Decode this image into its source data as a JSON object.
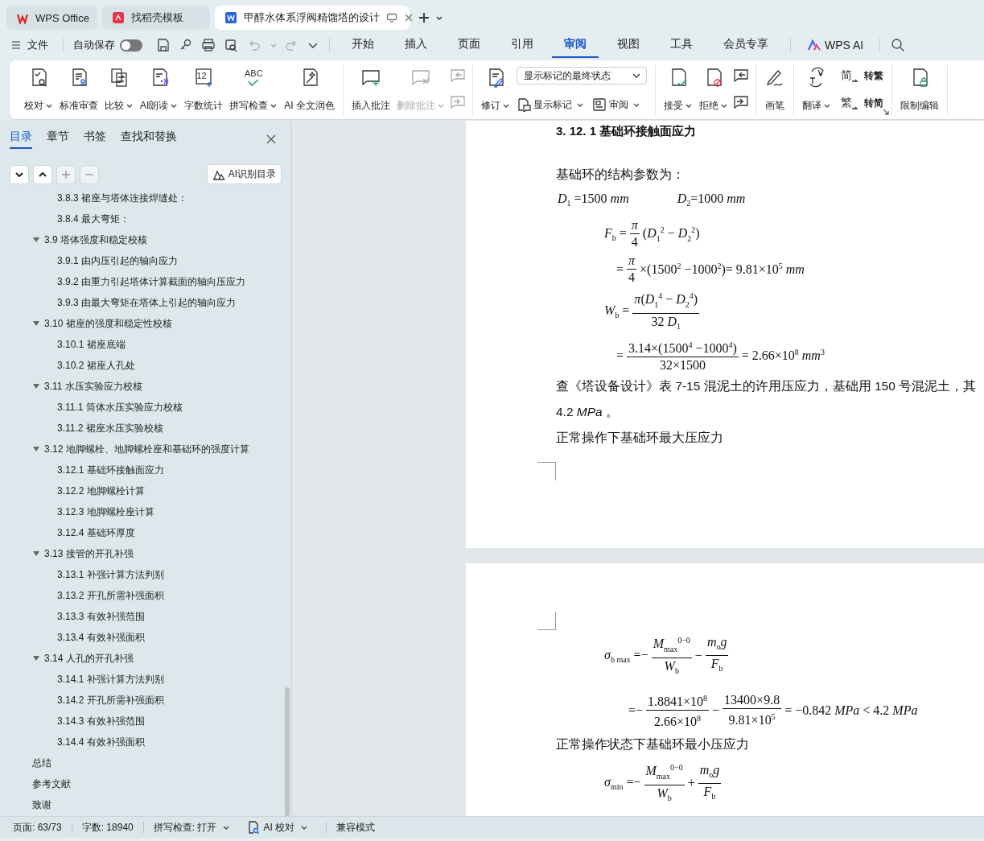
{
  "app_tabs": [
    {
      "label": "WPS Office",
      "selected": false
    },
    {
      "label": "找稻壳模板",
      "selected": false
    },
    {
      "label": "甲醇水体系浮阀精馏塔的设计",
      "selected": true
    }
  ],
  "menubar": {
    "file": "文件",
    "autosave": {
      "label": "自动保存",
      "on": false
    },
    "tabs": [
      {
        "label": "开始",
        "selected": false
      },
      {
        "label": "插入",
        "selected": false
      },
      {
        "label": "页面",
        "selected": false
      },
      {
        "label": "引用",
        "selected": false
      },
      {
        "label": "审阅",
        "selected": true
      },
      {
        "label": "视图",
        "selected": false
      },
      {
        "label": "工具",
        "selected": false
      },
      {
        "label": "会员专享",
        "selected": false
      }
    ],
    "ai_button": "WPS AI"
  },
  "ribbon": {
    "groups": [
      {
        "items": [
          {
            "kind": "large",
            "label": "校对",
            "caret": true,
            "disabled": false
          },
          {
            "kind": "large",
            "label": "标准审查",
            "caret": false,
            "disabled": false
          },
          {
            "kind": "large",
            "label": "比较",
            "caret": true,
            "disabled": false
          },
          {
            "kind": "large",
            "label": "AI朗读",
            "caret": true,
            "disabled": false
          },
          {
            "kind": "large",
            "label": "字数统计",
            "caret": false,
            "disabled": false,
            "glyph": "12"
          },
          {
            "kind": "large",
            "label": "拼写检查",
            "caret": true,
            "disabled": false,
            "glyph": "ABC"
          },
          {
            "kind": "large",
            "label": "AI 全文润色",
            "caret": false,
            "disabled": false
          }
        ]
      },
      {
        "items": [
          {
            "kind": "large",
            "label": "插入批注",
            "caret": false,
            "disabled": false
          },
          {
            "kind": "large",
            "label": "删除批注",
            "caret": true,
            "disabled": true
          },
          {
            "kind": "icon-pair",
            "disabled": true
          }
        ]
      },
      {
        "items": [
          {
            "kind": "large",
            "label": "修订",
            "caret": true,
            "disabled": false
          },
          {
            "kind": "stack",
            "select": "显示标记的最终状态",
            "buttons": [
              {
                "label": "显示标记",
                "caret": true
              },
              {
                "label": "审阅",
                "caret": true
              }
            ]
          }
        ]
      },
      {
        "items": [
          {
            "kind": "large",
            "label": "接受",
            "caret": true,
            "disabled": false
          },
          {
            "kind": "large",
            "label": "拒绝",
            "caret": true,
            "disabled": false
          },
          {
            "kind": "icon-pair",
            "disabled": false
          }
        ]
      },
      {
        "items": [
          {
            "kind": "large",
            "label": "画笔",
            "caret": false,
            "disabled": false
          }
        ]
      },
      {
        "items": [
          {
            "kind": "large",
            "label": "翻译",
            "caret": true,
            "disabled": false
          },
          {
            "kind": "convert",
            "buttons": [
              {
                "glyph": "简",
                "label": "转繁"
              },
              {
                "glyph": "繁",
                "label": "转简"
              }
            ]
          }
        ]
      },
      {
        "items": [
          {
            "kind": "large",
            "label": "限制编辑",
            "caret": false,
            "disabled": false
          }
        ]
      }
    ]
  },
  "nav_panel": {
    "tabs": [
      {
        "label": "目录",
        "selected": true
      },
      {
        "label": "章节",
        "selected": false
      },
      {
        "label": "书签",
        "selected": false
      },
      {
        "label": "查找和替换",
        "selected": false
      }
    ],
    "ai_button": "AI识别目录",
    "outline": [
      {
        "children": [
          {
            "label": "3.8.3 裙座与塔体连接焊缝处："
          },
          {
            "label": "3.8.4 最大弯矩："
          }
        ]
      },
      {
        "label": "3.9 塔体强度和稳定校核",
        "expanded": true,
        "children": [
          {
            "label": "3.9.1 由内压引起的轴向应力"
          },
          {
            "label": "3.9.2 由重力引起塔体计算截面的轴向压应力"
          },
          {
            "label": "3.9.3 由最大弯矩在塔体上引起的轴向应力"
          }
        ]
      },
      {
        "label": "3.10 裙座的强度和稳定性校核",
        "expanded": true,
        "children": [
          {
            "label": "3.10.1 裙座底端"
          },
          {
            "label": "3.10.2 裙座人孔处"
          }
        ]
      },
      {
        "label": "3.11 水压实验应力校核",
        "expanded": true,
        "children": [
          {
            "label": "3.11.1 筒体水压实验应力校核"
          },
          {
            "label": "3.11.2 裙座水压实验校核"
          }
        ]
      },
      {
        "label": "3.12 地脚螺栓、地脚螺栓座和基础环的强度计算",
        "expanded": true,
        "children": [
          {
            "label": "3.12.1 基础环接触面应力"
          },
          {
            "label": "3.12.2 地脚螺栓计算"
          },
          {
            "label": "3.12.3 地脚螺栓座计算"
          },
          {
            "label": "3.12.4 基础环厚度"
          }
        ]
      },
      {
        "label": "3.13 接管的开孔补强",
        "expanded": true,
        "children": [
          {
            "label": "3.13.1 补强计算方法判别"
          },
          {
            "label": "3.13.2 开孔所需补强面积"
          },
          {
            "label": "3.13.3 有效补强范围"
          },
          {
            "label": "3.13.4 有效补强面积"
          }
        ]
      },
      {
        "label": "3.14 人孔的开孔补强",
        "expanded": true,
        "children": [
          {
            "label": "3.14.1 补强计算方法判别"
          },
          {
            "label": "3.14.2 开孔所需补强面积"
          },
          {
            "label": "3.14.3 有效补强范围"
          },
          {
            "label": "3.14.4 有效补强面积"
          }
        ]
      },
      {
        "label": "总结"
      },
      {
        "label": "参考文献"
      },
      {
        "label": "致谢"
      }
    ]
  },
  "document": {
    "pages": [
      {
        "blocks": [
          {
            "kind": "heading",
            "text": "3. 12. 1 基础环接触面应力"
          },
          {
            "kind": "para",
            "text": "基础环的结构参数为："
          },
          {
            "kind": "vars",
            "items": [
              "*D*$_{1}$ =1500 *mm*",
              "*D*$_{2}$=1000 *mm*"
            ]
          },
          {
            "kind": "formula",
            "continued": false,
            "parts": [
              {
                "kind": "text",
                "s": "*F*$_{b}$ ="
              },
              {
                "kind": "frac",
                "num": "*π*",
                "den": "4"
              },
              {
                "kind": "text",
                "s": "(*D*$_{1}$$^{2}$ − *D*$_{2}$$^{2}$)"
              }
            ]
          },
          {
            "kind": "formula",
            "continued": true,
            "parts": [
              {
                "kind": "text",
                "s": "="
              },
              {
                "kind": "frac",
                "num": "*π*",
                "den": "4"
              },
              {
                "kind": "text",
                "s": "×(1500$^{2}$ −1000$^{2}$)= 9.81×10$^{5}$ *mm*"
              }
            ]
          },
          {
            "kind": "formula",
            "continued": false,
            "parts": [
              {
                "kind": "text",
                "s": "*W*$_{b}$ ="
              },
              {
                "kind": "frac",
                "num": "*π*(*D*$_{1}$$^{4}$ − *D*$_{2}$$^{4}$)",
                "den": "32 *D*$_{1}$"
              }
            ]
          },
          {
            "kind": "formula",
            "continued": true,
            "parts": [
              {
                "kind": "text",
                "s": "="
              },
              {
                "kind": "frac",
                "num": "3.14×(1500$^{4}$ −1000$^{4}$)",
                "den": "32×1500"
              },
              {
                "kind": "text",
                "s": "= 2.66×10$^{8}$ *mm*$^{3}$"
              }
            ]
          },
          {
            "kind": "para",
            "text": "查《塔设备设计》表 7-15 混泥土的许用压应力，基础用 150 号混泥土，其"
          },
          {
            "kind": "para",
            "text": "4.2 *MPa* 。"
          },
          {
            "kind": "para",
            "text": "正常操作下基础环最大压应力"
          }
        ]
      },
      {
        "blocks": [
          {
            "kind": "formula",
            "continued": false,
            "parts": [
              {
                "kind": "text",
                "s": "*σ*$_{b max}$ =−"
              },
              {
                "kind": "frac",
                "num": "*M*$_{max}$$^{0−0}$",
                "den": "*W*$_{b}$"
              },
              {
                "kind": "text",
                "s": "−"
              },
              {
                "kind": "frac",
                "num": "*m*$_{o}$*g*",
                "den": "*F*$_{b}$"
              }
            ]
          },
          {
            "kind": "formula",
            "continued": true,
            "parts": [
              {
                "kind": "text",
                "s": "=−"
              },
              {
                "kind": "frac",
                "num": "1.8841×10$^{8}$",
                "den": "2.66×10$^{8}$"
              },
              {
                "kind": "text",
                "s": "−"
              },
              {
                "kind": "frac",
                "num": "13400×9.8",
                "den": "9.81×10$^{5}$"
              },
              {
                "kind": "text",
                "s": "= −0.842 *MPa* < 4.2 *MPa*"
              }
            ]
          },
          {
            "kind": "para",
            "text": "正常操作状态下基础环最小压应力"
          },
          {
            "kind": "formula",
            "continued": false,
            "parts": [
              {
                "kind": "text",
                "s": "*σ*$_{min}$ =−"
              },
              {
                "kind": "frac",
                "num": "*M*$_{max}$$^{0−0}$",
                "den": "*W*$_{b}$"
              },
              {
                "kind": "text",
                "s": "+"
              },
              {
                "kind": "frac",
                "num": "*m*$_{o}$*g*",
                "den": "*F*$_{b}$"
              }
            ]
          }
        ]
      }
    ]
  },
  "status_bar": {
    "page": "页面: 63/73",
    "words": "字数: 18940",
    "spell": "拼写检查: 打开",
    "ai_check": "AI 校对",
    "mode": "兼容模式"
  }
}
